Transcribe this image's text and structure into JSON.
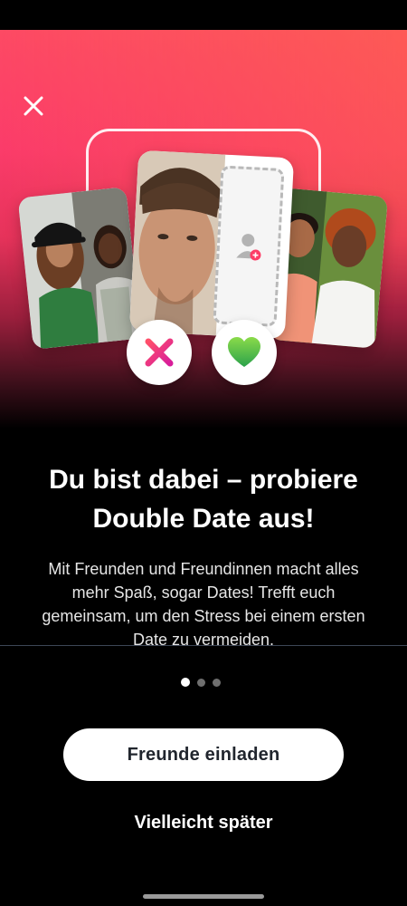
{
  "onboarding": {
    "headline": "Du bist dabei – probiere Double Date aus!",
    "description": "Mit Freunden und Freundinnen macht alles mehr Spaß, sogar Dates! Trefft euch gemeinsam, um den Stress bei einem ersten Date zu vermeiden.",
    "pager": {
      "total_pages": 3,
      "current_page": 1
    },
    "primary_button": "Freunde einladen",
    "secondary_button": "Vielleicht später"
  },
  "icons": {
    "close": "close-icon",
    "dislike": "x-icon",
    "like": "heart-icon",
    "add_person": "add-person-icon"
  },
  "colors": {
    "gradient_top": "#fd4a64",
    "gradient_mid": "#e6335b",
    "background": "#000000",
    "dislike_gradient_start": "#ff4f6a",
    "dislike_gradient_end": "#d81d9a",
    "like_gradient_start": "#8bdb4a",
    "like_gradient_end": "#2ba24b",
    "primary_button_bg": "#ffffff",
    "primary_button_text": "#21262e"
  }
}
